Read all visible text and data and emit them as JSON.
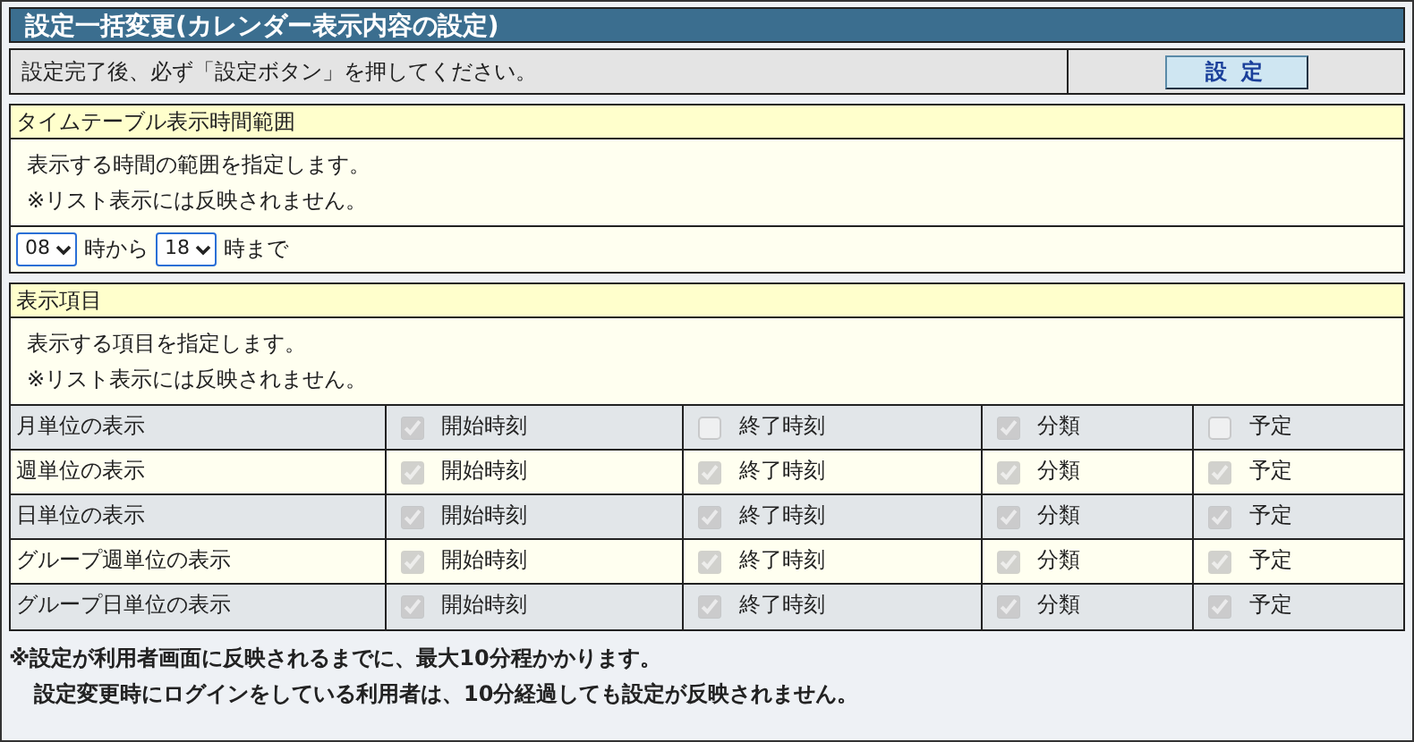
{
  "title": "設定一括変更(カレンダー表示内容の設定)",
  "instruction": "設定完了後、必ず「設定ボタン」を押してください。",
  "submit_button": "設 定",
  "timetable": {
    "header": "タイムテーブル表示時間範囲",
    "notes": [
      "表示する時間の範囲を指定します。",
      "※リスト表示には反映されません。"
    ],
    "from_value": "08",
    "from_label": "時から",
    "to_value": "18",
    "to_label": "時まで"
  },
  "display_items": {
    "header": "表示項目",
    "notes": [
      "表示する項目を指定します。",
      "※リスト表示には反映されません。"
    ],
    "rows": [
      {
        "label": "月単位の表示",
        "options": [
          {
            "label": "開始時刻",
            "checked": true
          },
          {
            "label": "終了時刻",
            "checked": false
          },
          {
            "label": "分類",
            "checked": true
          },
          {
            "label": "予定",
            "checked": false
          }
        ]
      },
      {
        "label": "週単位の表示",
        "options": [
          {
            "label": "開始時刻",
            "checked": true
          },
          {
            "label": "終了時刻",
            "checked": true
          },
          {
            "label": "分類",
            "checked": true
          },
          {
            "label": "予定",
            "checked": true
          }
        ]
      },
      {
        "label": "日単位の表示",
        "options": [
          {
            "label": "開始時刻",
            "checked": true
          },
          {
            "label": "終了時刻",
            "checked": true
          },
          {
            "label": "分類",
            "checked": true
          },
          {
            "label": "予定",
            "checked": true
          }
        ]
      },
      {
        "label": "グループ週単位の表示",
        "options": [
          {
            "label": "開始時刻",
            "checked": true
          },
          {
            "label": "終了時刻",
            "checked": true
          },
          {
            "label": "分類",
            "checked": true
          },
          {
            "label": "予定",
            "checked": true
          }
        ]
      },
      {
        "label": "グループ日単位の表示",
        "options": [
          {
            "label": "開始時刻",
            "checked": true
          },
          {
            "label": "終了時刻",
            "checked": true
          },
          {
            "label": "分類",
            "checked": true
          },
          {
            "label": "予定",
            "checked": true
          }
        ]
      }
    ]
  },
  "footer_notes": [
    "※設定が利用者画面に反映されるまでに、最大10分程かかります。",
    "設定変更時にログインをしている利用者は、10分経過しても設定が反映されません。"
  ]
}
